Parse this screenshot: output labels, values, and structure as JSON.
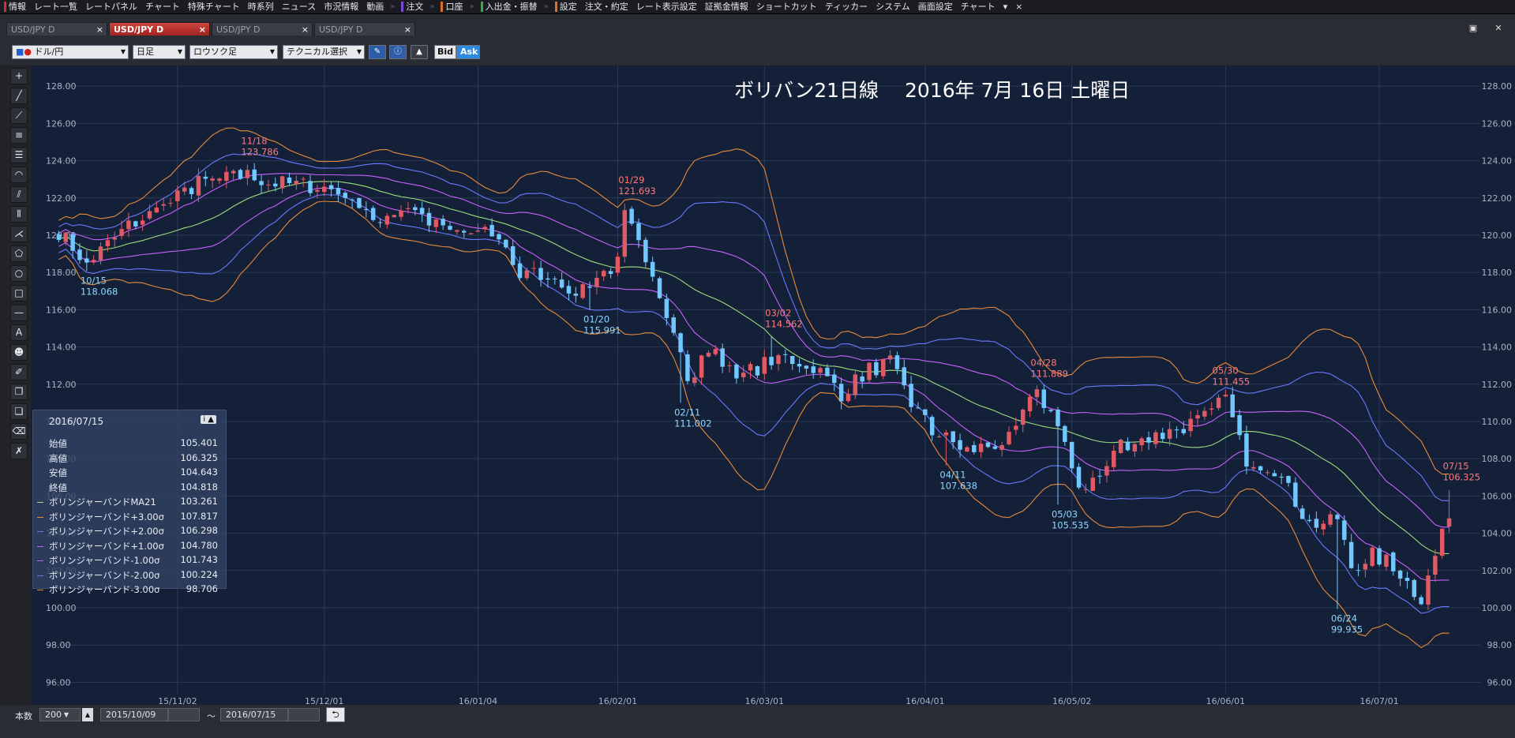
{
  "menu": [
    {
      "label": "情報",
      "mark": "#d03030"
    },
    {
      "label": "レート一覧",
      "mark": ""
    },
    {
      "label": "レートパネル",
      "mark": ""
    },
    {
      "label": "チャート",
      "mark": ""
    },
    {
      "label": "特殊チャート",
      "mark": ""
    },
    {
      "label": "時系列",
      "mark": ""
    },
    {
      "label": "ニュース",
      "mark": ""
    },
    {
      "label": "市況情報",
      "mark": ""
    },
    {
      "label": "動画",
      "mark": ""
    },
    {
      "label": "注文",
      "mark": "#7a4ad8"
    },
    {
      "label": "口座",
      "mark": "#e07020"
    },
    {
      "label": "入出金・振替",
      "mark": "#30b040"
    },
    {
      "label": "設定",
      "mark": "#e07020"
    },
    {
      "label": "注文・約定",
      "mark": ""
    },
    {
      "label": "レート表示設定",
      "mark": ""
    },
    {
      "label": "証拠金情報",
      "mark": ""
    },
    {
      "label": "ショートカット",
      "mark": ""
    },
    {
      "label": "ティッカー",
      "mark": ""
    },
    {
      "label": "システム",
      "mark": ""
    },
    {
      "label": "画面設定",
      "mark": ""
    },
    {
      "label": "チャート",
      "mark": ""
    }
  ],
  "menu_end": [
    "▾",
    "×"
  ],
  "tabs": [
    {
      "label": "USD/JPY D",
      "active": false
    },
    {
      "label": "USD/JPY D",
      "active": true
    },
    {
      "label": "USD/JPY D",
      "active": false
    },
    {
      "label": "USD/JPY D",
      "active": false
    }
  ],
  "tab_close": "×",
  "toolbar": {
    "pair": "ドル/円",
    "timeframe": "日足",
    "chart_type": "ロウソク足",
    "technical": "テクニカル選択",
    "bid": "Bid",
    "ask": "Ask"
  },
  "chart_title": "ボリバン21日線　 2016年 7月 16日 土曜日",
  "info": {
    "date": "2016/07/15",
    "rows": [
      {
        "k": "始値",
        "v": "105.401",
        "c": ""
      },
      {
        "k": "高値",
        "v": "106.325",
        "c": ""
      },
      {
        "k": "安値",
        "v": "104.643",
        "c": ""
      },
      {
        "k": "終値",
        "v": "104.818",
        "c": ""
      },
      {
        "k": "ボリンジャーバンドMA21",
        "v": "103.261",
        "c": "#9be07a"
      },
      {
        "k": "ボリンジャーバンド+3.00σ",
        "v": "107.817",
        "c": "#e88a3a"
      },
      {
        "k": "ボリンジャーバンド+2.00σ",
        "v": "106.298",
        "c": "#6a78ff"
      },
      {
        "k": "ボリンジャーバンド+1.00σ",
        "v": "104.780",
        "c": "#c860ff"
      },
      {
        "k": "ボリンジャーバンド-1.00σ",
        "v": "101.743",
        "c": "#c860ff"
      },
      {
        "k": "ボリンジャーバンド-2.00σ",
        "v": "100.224",
        "c": "#6a78ff"
      },
      {
        "k": "ボリンジャーバンド-3.00σ",
        "v": "98.706",
        "c": "#e88a3a"
      }
    ]
  },
  "status": {
    "count_label": "本数",
    "count_value": "200",
    "from": "2015/10/09",
    "tilde": "～",
    "to": "2016/07/15"
  },
  "chart_data": {
    "type": "candlestick",
    "y_ticks": [
      "128.00",
      "126.00",
      "124.00",
      "122.00",
      "120.00",
      "118.00",
      "116.00",
      "114.00",
      "112.00",
      "110.00",
      "108.00",
      "106.00",
      "104.00",
      "102.00",
      "100.00",
      "98.00",
      "96.00"
    ],
    "ylim": [
      95,
      128.6
    ],
    "x_ticks": [
      {
        "label": "15/11/02",
        "idx": 17
      },
      {
        "label": "15/12/01",
        "idx": 38
      },
      {
        "label": "16/01/04",
        "idx": 60
      },
      {
        "label": "16/02/01",
        "idx": 80
      },
      {
        "label": "16/03/01",
        "idx": 101
      },
      {
        "label": "16/04/01",
        "idx": 124
      },
      {
        "label": "16/05/02",
        "idx": 145
      },
      {
        "label": "16/06/01",
        "idx": 167
      },
      {
        "label": "16/07/01",
        "idx": 189
      }
    ],
    "key_points": [
      {
        "idx": 0,
        "v": 120.2
      },
      {
        "idx": 4,
        "v": 118.5
      },
      {
        "idx": 10,
        "v": 120.5
      },
      {
        "idx": 15,
        "v": 121.5
      },
      {
        "idx": 20,
        "v": 122.8
      },
      {
        "idx": 27,
        "v": 123.2
      },
      {
        "idx": 31,
        "v": 122.8
      },
      {
        "idx": 38,
        "v": 122.6
      },
      {
        "idx": 41,
        "v": 122.4
      },
      {
        "idx": 45,
        "v": 120.8
      },
      {
        "idx": 50,
        "v": 121.6
      },
      {
        "idx": 55,
        "v": 120.2
      },
      {
        "idx": 63,
        "v": 120.0
      },
      {
        "idx": 66,
        "v": 117.8
      },
      {
        "idx": 70,
        "v": 118.0
      },
      {
        "idx": 74,
        "v": 117.0
      },
      {
        "idx": 80,
        "v": 118.5
      },
      {
        "idx": 81,
        "v": 121.0
      },
      {
        "idx": 85,
        "v": 118.0
      },
      {
        "idx": 88,
        "v": 115.0
      },
      {
        "idx": 90,
        "v": 112.0
      },
      {
        "idx": 93,
        "v": 113.8
      },
      {
        "idx": 98,
        "v": 112.5
      },
      {
        "idx": 103,
        "v": 113.5
      },
      {
        "idx": 108,
        "v": 113.0
      },
      {
        "idx": 112,
        "v": 111.5
      },
      {
        "idx": 116,
        "v": 112.8
      },
      {
        "idx": 119,
        "v": 113.1
      },
      {
        "idx": 122,
        "v": 111.0
      },
      {
        "idx": 125,
        "v": 109.5
      },
      {
        "idx": 130,
        "v": 108.4
      },
      {
        "idx": 136,
        "v": 109.0
      },
      {
        "idx": 140,
        "v": 111.6
      },
      {
        "idx": 142,
        "v": 110.5
      },
      {
        "idx": 146,
        "v": 106.5
      },
      {
        "idx": 149,
        "v": 107.0
      },
      {
        "idx": 152,
        "v": 108.8
      },
      {
        "idx": 158,
        "v": 109.3
      },
      {
        "idx": 164,
        "v": 110.2
      },
      {
        "idx": 167,
        "v": 111.2
      },
      {
        "idx": 170,
        "v": 108.0
      },
      {
        "idx": 174,
        "v": 107.5
      },
      {
        "idx": 179,
        "v": 104.5
      },
      {
        "idx": 183,
        "v": 104.6
      },
      {
        "idx": 185,
        "v": 102.2
      },
      {
        "idx": 188,
        "v": 102.8
      },
      {
        "idx": 191,
        "v": 102.3
      },
      {
        "idx": 195,
        "v": 100.4
      },
      {
        "idx": 197,
        "v": 102.8
      },
      {
        "idx": 199,
        "v": 104.8
      }
    ],
    "annotations": [
      {
        "date": "10/15",
        "value": "118.068",
        "idx": 4,
        "y": 118.068,
        "kind": "low"
      },
      {
        "date": "11/18",
        "value": "123.786",
        "idx": 27,
        "y": 123.786,
        "kind": "high"
      },
      {
        "date": "01/20",
        "value": "115.991",
        "idx": 76,
        "y": 115.991,
        "kind": "low"
      },
      {
        "date": "01/29",
        "value": "121.693",
        "idx": 81,
        "y": 121.693,
        "kind": "high"
      },
      {
        "date": "02/11",
        "value": "111.002",
        "idx": 89,
        "y": 111.002,
        "kind": "low"
      },
      {
        "date": "03/02",
        "value": "114.562",
        "idx": 102,
        "y": 114.562,
        "kind": "high"
      },
      {
        "date": "04/11",
        "value": "107.638",
        "idx": 127,
        "y": 107.638,
        "kind": "low"
      },
      {
        "date": "04/28",
        "value": "111.889",
        "idx": 140,
        "y": 111.889,
        "kind": "high"
      },
      {
        "date": "05/03",
        "value": "105.535",
        "idx": 143,
        "y": 105.535,
        "kind": "low"
      },
      {
        "date": "05/30",
        "value": "111.455",
        "idx": 166,
        "y": 111.455,
        "kind": "high"
      },
      {
        "date": "06/24",
        "value": "99.935",
        "idx": 183,
        "y": 99.935,
        "kind": "low"
      },
      {
        "date": "07/15",
        "value": "106.325",
        "idx": 199,
        "y": 106.325,
        "kind": "high"
      }
    ],
    "n_bars": 200,
    "bands_sigma": [
      3,
      2,
      1
    ],
    "colors": {
      "up": "#e05a64",
      "down": "#70c8ff",
      "ma": "#9be07a",
      "s1": "#c860ff",
      "s2": "#6a78ff",
      "s3": "#e88a3a",
      "grid": "#2a3a58",
      "axis_text": "#aab3c4",
      "high_label": "#ff7a7a",
      "low_label": "#8fd8ff"
    }
  }
}
